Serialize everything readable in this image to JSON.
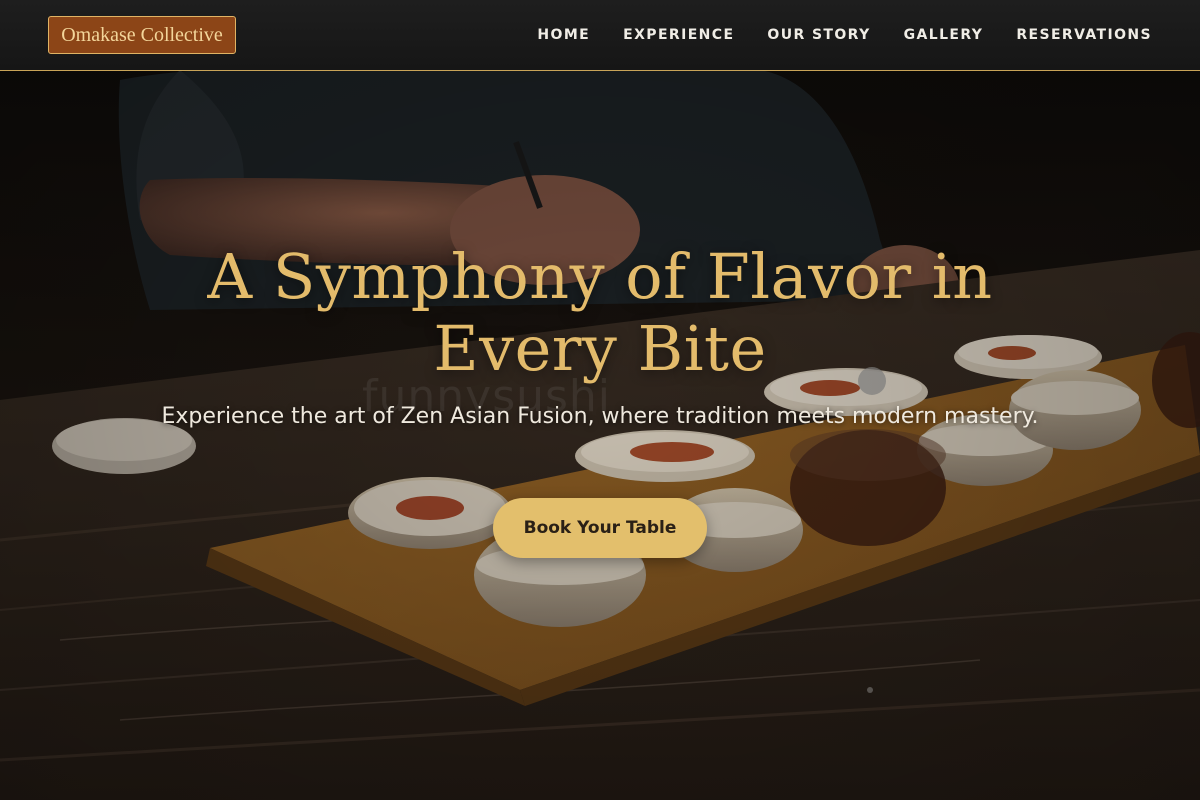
{
  "brand": {
    "name": "Omakase Collective"
  },
  "nav": {
    "items": [
      {
        "label": "HOME"
      },
      {
        "label": "EXPERIENCE"
      },
      {
        "label": "OUR STORY"
      },
      {
        "label": "GALLERY"
      },
      {
        "label": "RESERVATIONS"
      }
    ]
  },
  "hero": {
    "title": "A Symphony of Flavor in Every Bite",
    "subtitle": "Experience the art of Zen Asian Fusion, where tradition meets modern mastery.",
    "cta_label": "Book Your Table",
    "watermark": "funnysushi"
  },
  "colors": {
    "accent_gold": "#e3bb6b",
    "button_gold": "#e3bf6c",
    "logo_brown": "#8c4517",
    "nav_bg": "#1a1a1a"
  },
  "icons": []
}
